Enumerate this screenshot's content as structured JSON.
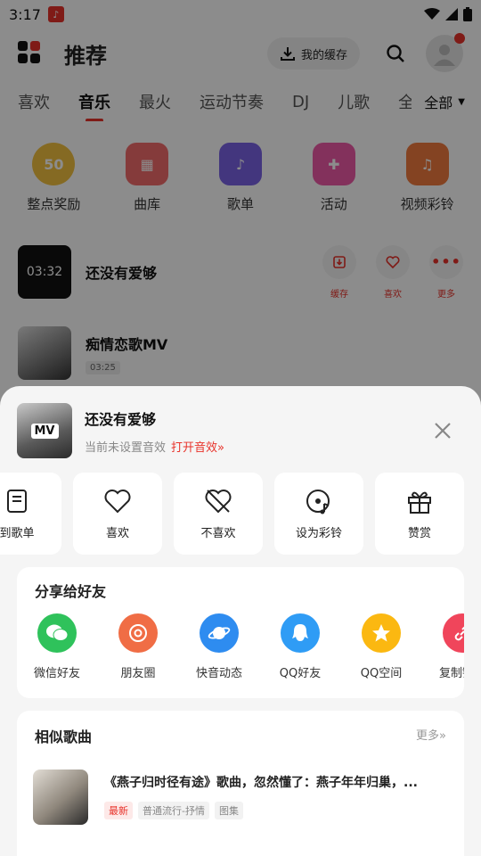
{
  "status_bar": {
    "time": "3:17"
  },
  "header": {
    "title": "推荐",
    "cache_label": "我的缓存"
  },
  "tabs": [
    "喜欢",
    "音乐",
    "最火",
    "运动节奏",
    "DJ",
    "儿歌",
    "全"
  ],
  "tabs_all": "全部",
  "quick_entries": [
    {
      "label": "整点奖励",
      "icon": "coin-50-icon",
      "badge": "50",
      "color": "#f3c241"
    },
    {
      "label": "曲库",
      "icon": "library-grid-icon",
      "color": "#f26c6c"
    },
    {
      "label": "歌单",
      "icon": "music-note-icon",
      "color": "#7b63e6"
    },
    {
      "label": "活动",
      "icon": "gift-icon",
      "color": "#ee5aa8"
    },
    {
      "label": "视频彩铃",
      "icon": "bell-icon",
      "color": "#f07a3e"
    }
  ],
  "list": [
    {
      "title": "还没有爱够",
      "duration": "03:32",
      "actions": [
        "缓存",
        "喜欢",
        "更多"
      ]
    },
    {
      "title": "痴情恋歌MV",
      "duration": "03:25"
    }
  ],
  "sheet": {
    "title": "还没有爱够",
    "cover_badge": "MV",
    "subtitle": "当前未设置音效",
    "subtitle_link": "打开音效»",
    "actions": [
      {
        "label": "到歌单",
        "icon": "add-to-playlist-icon"
      },
      {
        "label": "喜欢",
        "icon": "heart-icon"
      },
      {
        "label": "不喜欢",
        "icon": "dislike-heart-icon"
      },
      {
        "label": "设为彩铃",
        "icon": "ringtone-icon"
      },
      {
        "label": "赞赏",
        "icon": "gift-icon"
      }
    ],
    "share": {
      "title": "分享给好友",
      "items": [
        {
          "label": "微信好友",
          "icon": "wechat-icon",
          "color": "#2fc25b"
        },
        {
          "label": "朋友圈",
          "icon": "moments-icon",
          "color": "#f06d45"
        },
        {
          "label": "快音动态",
          "icon": "planet-icon",
          "color": "#2e8cf0"
        },
        {
          "label": "QQ好友",
          "icon": "qq-icon",
          "color": "#2f9cf5"
        },
        {
          "label": "QQ空间",
          "icon": "qzone-star-icon",
          "color": "#fbb811"
        },
        {
          "label": "复制链接",
          "icon": "link-icon",
          "color": "#f0455b"
        }
      ]
    },
    "similar": {
      "title": "相似歌曲",
      "more": "更多»",
      "song_title": "《燕子归时径有途》歌曲，忽然懂了：燕子年年归巢，...",
      "tags": [
        "最新",
        "普通流行-抒情",
        "图集"
      ]
    }
  }
}
